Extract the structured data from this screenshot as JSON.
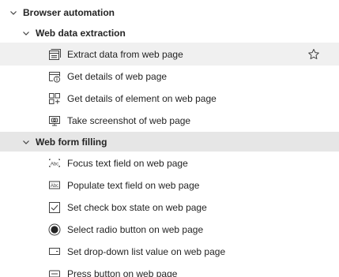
{
  "tree": {
    "browser_automation": {
      "label": "Browser automation",
      "icon": "chevron-down-icon"
    },
    "web_data_extraction": {
      "label": "Web data extraction",
      "icon": "chevron-down-icon",
      "actions": [
        {
          "label": "Extract data from web page",
          "icon": "window-stack-icon"
        },
        {
          "label": "Get details of web page",
          "icon": "page-info-icon"
        },
        {
          "label": "Get details of element on web page",
          "icon": "element-grid-icon"
        },
        {
          "label": "Take screenshot of web page",
          "icon": "screenshot-icon"
        }
      ]
    },
    "web_form_filling": {
      "label": "Web form filling",
      "icon": "chevron-down-icon",
      "actions": [
        {
          "label": "Focus text field on web page",
          "icon": "focus-text-field-icon"
        },
        {
          "label": "Populate text field on web page",
          "icon": "populate-text-field-icon"
        },
        {
          "label": "Set check box state on web page",
          "icon": "checkbox-icon"
        },
        {
          "label": "Select radio button on web page",
          "icon": "radio-button-icon"
        },
        {
          "label": "Set drop-down list value on web page",
          "icon": "dropdown-icon"
        },
        {
          "label": "Press button on web page",
          "icon": "button-icon"
        }
      ]
    }
  },
  "favorite_icon": "star-icon",
  "colors": {
    "hover_row": "#f0f0f0",
    "group_row": "#e6e6e6",
    "text": "#242424"
  }
}
